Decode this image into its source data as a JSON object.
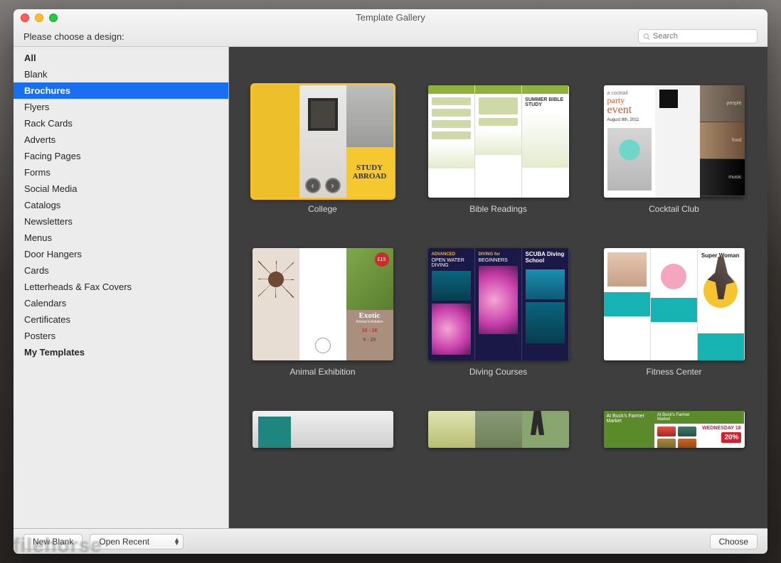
{
  "window": {
    "title": "Template Gallery",
    "subtitle": "Please choose a design:"
  },
  "search": {
    "placeholder": "Search"
  },
  "sidebar": {
    "items": [
      {
        "label": "All",
        "bold": true
      },
      {
        "label": "Blank"
      },
      {
        "label": "Brochures",
        "selected": true
      },
      {
        "label": "Flyers"
      },
      {
        "label": "Rack Cards"
      },
      {
        "label": "Adverts"
      },
      {
        "label": "Facing Pages"
      },
      {
        "label": "Forms"
      },
      {
        "label": "Social Media"
      },
      {
        "label": "Catalogs"
      },
      {
        "label": "Newsletters"
      },
      {
        "label": "Menus"
      },
      {
        "label": "Door Hangers"
      },
      {
        "label": "Cards"
      },
      {
        "label": "Letterheads & Fax Covers"
      },
      {
        "label": "Calendars"
      },
      {
        "label": "Certificates"
      },
      {
        "label": "Posters"
      },
      {
        "label": "My Templates",
        "bold": true
      }
    ]
  },
  "templates": {
    "row1": [
      {
        "label": "College",
        "selected": true,
        "study": "STUDY ABROAD"
      },
      {
        "label": "Bible Readings",
        "ttl": "SUMMER BIBLE STUDY"
      },
      {
        "label": "Cocktail Club",
        "ev_prefix": "a cocktail",
        "ev_line2": "party",
        "ev_line3": "event",
        "date": "August 8th, 2011",
        "s1": "people",
        "s2": "food",
        "s3": "music"
      }
    ],
    "row2": [
      {
        "label": "Animal Exhibition",
        "ex": "Exotic",
        "sub": "Animal Exhibition",
        "badge": "£15",
        "d1": "10 - 18",
        "d2": "9 - 20"
      },
      {
        "label": "Diving Courses",
        "h1": "ADVANCED",
        "t1": "OPEN WATER DIVING",
        "h2": "DIVING for",
        "t2": "BEGINNERS",
        "ds": "SCUBA Diving School"
      },
      {
        "label": "Fitness Center",
        "sw": "Super Woman"
      }
    ],
    "row3": [
      {
        "label": ""
      },
      {
        "label": ""
      },
      {
        "label": "",
        "mk": "At Buck's Farmer Market",
        "wed": "WEDNESDAY 18",
        "off": "20%"
      }
    ]
  },
  "footer": {
    "new_blank": "New Blank",
    "open_recent": "Open Recent",
    "choose": "Choose"
  },
  "watermark": "filehorse"
}
